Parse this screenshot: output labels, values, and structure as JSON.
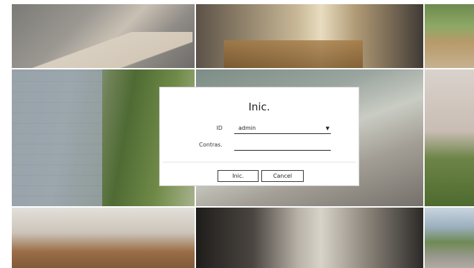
{
  "login": {
    "title": "Inic.",
    "id_label": "ID",
    "id_value": "admin",
    "password_label": "Contras.",
    "password_value": "",
    "login_button": "Inic.",
    "cancel_button": "Cancel"
  },
  "icons": {
    "dropdown": "chevron-down-icon"
  },
  "colors": {
    "dialog_background": "#ffffff",
    "text": "#222222",
    "border": "#333333"
  }
}
